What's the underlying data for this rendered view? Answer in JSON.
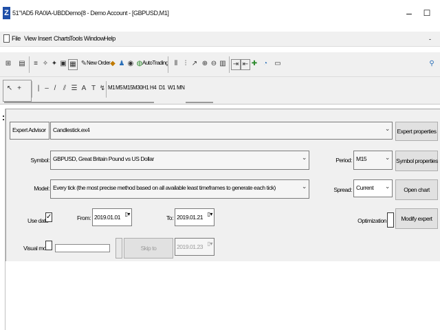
{
  "window": {
    "title": "51\"!AD5 RA0IA-UBDDemo{8 - Demo Account - [GBPUSD,M1]",
    "app_icon_letter": "Z",
    "minimize": "–",
    "maximize": "☐"
  },
  "menu": {
    "items": [
      "File",
      "View",
      "Insert",
      "Charts",
      "Tools",
      "Window",
      "Help"
    ],
    "close_glyph": "-"
  },
  "toolbar": {
    "new_order": "New Order",
    "autotrading": "AutoTrading",
    "timeframes": [
      "M1",
      "M5",
      "M15",
      "M30",
      "H1",
      "H4",
      "D1",
      "W1",
      "MN"
    ]
  },
  "tester": {
    "expert_advisor_type": "Expert Advisor",
    "expert_file": "Candlestick.ex4",
    "expert_properties": "Expert properties",
    "symbol_label": "Symbol:",
    "symbol_value": "GBPUSD, Great Britain Pound vs US Dollar",
    "period_label": "Period:",
    "period_value": "M15",
    "symbol_properties": "Symbol properties",
    "model_label": "Model:",
    "model_value": "Every tick (the most precise method based on all available least timeframes to generate each tick)",
    "spread_label": "Spread:",
    "spread_value": "Current",
    "open_chart": "Open chart",
    "use_date_label": "Use date",
    "use_date_checked": true,
    "from_label": "From:",
    "from_value": "2019.01.01",
    "to_label": "To:",
    "to_value": "2019.01.21",
    "optimization_label": "Optimization",
    "optimization_checked": false,
    "modify_expert": "Modify expert",
    "visual_mode_label": "Visual mode",
    "visual_mode_checked": false,
    "skip_to_label": "Skip to",
    "skip_to_value": "2019.01.23"
  },
  "colors": {
    "accent": "#1f4fa8",
    "panel_bg": "#f0f0f0",
    "button_bg": "#e1e1e1"
  }
}
